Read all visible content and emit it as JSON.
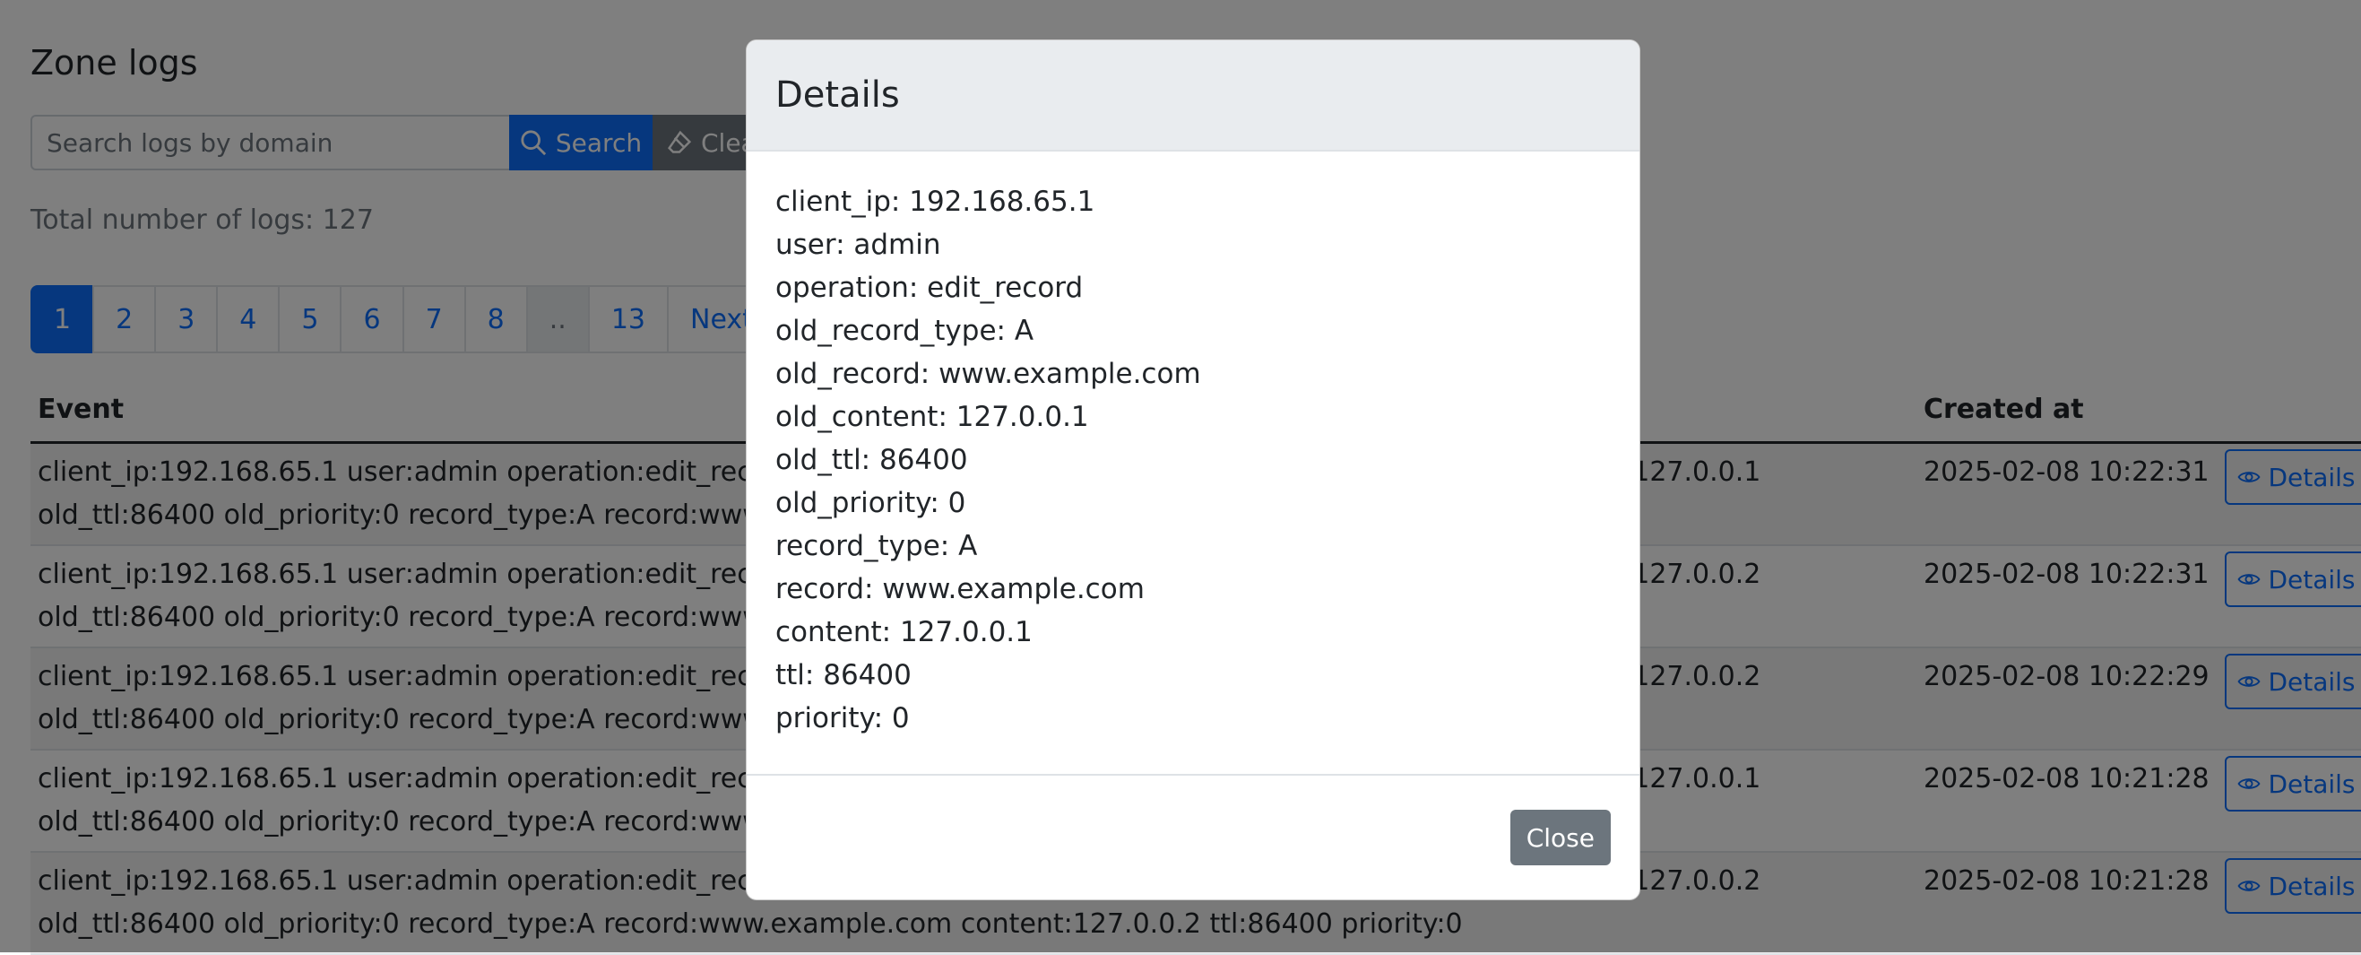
{
  "page": {
    "title": "Zone logs",
    "search": {
      "placeholder": "Search logs by domain",
      "value": "",
      "search_label": "Search",
      "search_icon": "search-icon",
      "clear_label": "Clear",
      "clear_icon": "eraser-icon"
    },
    "total_text": "Total number of logs: 127",
    "pagination": [
      "1",
      "2",
      "3",
      "4",
      "5",
      "6",
      "7",
      "8",
      "..",
      "13",
      "Next"
    ],
    "pagination_active": "1",
    "table": {
      "headers": {
        "event": "Event",
        "created_at": "Created at"
      },
      "details_label": "Details",
      "details_icon": "eye-icon",
      "rows": [
        {
          "event": "client_ip:192.168.65.1 user:admin operation:edit_record old_record_type:A old_record:www.example.com old_content:127.0.0.1 old_ttl:86400 old_priority:0 record_type:A record:www.example.com content:127.0.0.1 ttl:86400 priority:0",
          "created_at": "2025-02-08 10:22:31"
        },
        {
          "event": "client_ip:192.168.65.1 user:admin operation:edit_record old_record_type:A old_record:www.example.com old_content:127.0.0.2 old_ttl:86400 old_priority:0 record_type:A record:www.example.com content:127.0.0.1 ttl:86400 priority:0",
          "created_at": "2025-02-08 10:22:31"
        },
        {
          "event": "client_ip:192.168.65.1 user:admin operation:edit_record old_record_type:A old_record:www.example.com old_content:127.0.0.2 old_ttl:86400 old_priority:0 record_type:A record:www.example.com content:127.0.0.2 ttl:86400 priority:0",
          "created_at": "2025-02-08 10:22:29"
        },
        {
          "event": "client_ip:192.168.65.1 user:admin operation:edit_record old_record_type:A old_record:www.example.com old_content:127.0.0.1 old_ttl:86400 old_priority:0 record_type:A record:www.example.com content:127.0.0.2 ttl:86400 priority:0",
          "created_at": "2025-02-08 10:21:28"
        },
        {
          "event": "client_ip:192.168.65.1 user:admin operation:edit_record old_record_type:A old_record:www.example.com old_content:127.0.0.2 old_ttl:86400 old_priority:0 record_type:A record:www.example.com content:127.0.0.2 ttl:86400 priority:0",
          "created_at": "2025-02-08 10:21:28"
        }
      ]
    }
  },
  "modal": {
    "title": "Details",
    "lines": [
      "client_ip: 192.168.65.1",
      "user: admin",
      "operation: edit_record",
      "old_record_type: A",
      "old_record: www.example.com",
      "old_content: 127.0.0.1",
      "old_ttl: 86400",
      "old_priority: 0",
      "record_type: A",
      "record: www.example.com",
      "content: 127.0.0.1",
      "ttl: 86400",
      "priority: 0"
    ],
    "close_label": "Close"
  },
  "colors": {
    "primary": "#0d6efd",
    "secondary": "#6c757d",
    "backdrop": "rgba(0,0,0,0.5)"
  }
}
